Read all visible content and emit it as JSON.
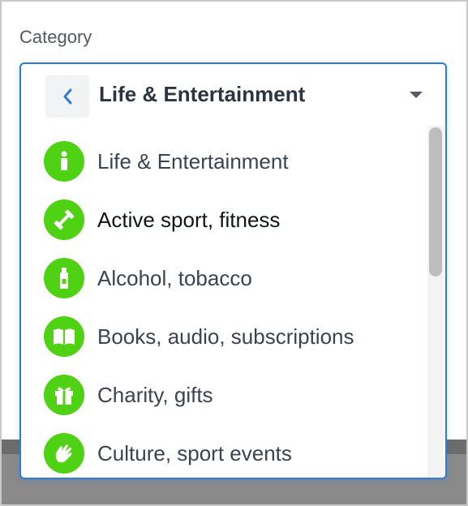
{
  "field": {
    "label": "Category"
  },
  "dropdown": {
    "selected_title": "Life & Entertainment",
    "back_icon": "chevron-left-icon",
    "caret_icon": "caret-down-icon",
    "items": [
      {
        "label": "Life & Entertainment",
        "icon": "person-icon"
      },
      {
        "label": "Active sport, fitness",
        "icon": "dumbbell-icon"
      },
      {
        "label": "Alcohol, tobacco",
        "icon": "bottle-icon"
      },
      {
        "label": "Books, audio, subscriptions",
        "icon": "book-icon"
      },
      {
        "label": "Charity, gifts",
        "icon": "gift-icon"
      },
      {
        "label": "Culture, sport events",
        "icon": "hands-icon"
      }
    ]
  },
  "colors": {
    "accent_border": "#2e7bd6",
    "icon_green": "#4fd114",
    "back_chevron": "#2e7bd6"
  }
}
